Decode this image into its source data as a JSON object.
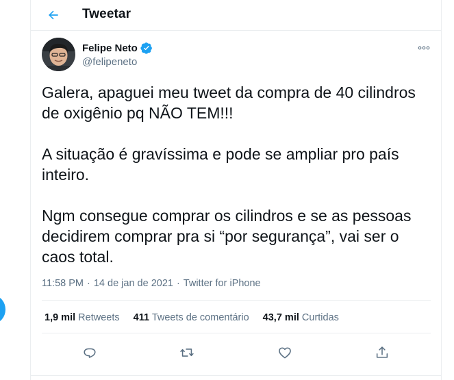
{
  "header": {
    "title": "Tweetar",
    "back_icon": "arrow-left-icon"
  },
  "author": {
    "name": "Felipe Neto",
    "handle": "@felipeneto",
    "verified": true,
    "verified_color": "#1da1f2"
  },
  "tweet": {
    "text": "Galera, apaguei meu tweet da compra de 40 cilindros\nde oxigênio pq NÃO TEM!!!\n\nA situação é gravíssima e pode se ampliar pro país\ninteiro.\n\nNgm consegue comprar os cilindros e se as pessoas\ndecidirem comprar pra si “por segurança”, vai ser o\ncaos total.",
    "time": "11:58 PM",
    "separator1": "·",
    "date": "14 de jan de 2021",
    "separator2": "·",
    "source": "Twitter for iPhone"
  },
  "stats": {
    "retweets_count": "1,9 mil",
    "retweets_label": "Retweets",
    "quotes_count": "411",
    "quotes_label": "Tweets de comentário",
    "likes_count": "43,7 mil",
    "likes_label": "Curtidas"
  },
  "actions": [
    {
      "name": "reply-icon"
    },
    {
      "name": "retweet-icon"
    },
    {
      "name": "like-icon"
    },
    {
      "name": "share-icon"
    }
  ],
  "colors": {
    "accent": "#1da1f2",
    "secondary_text": "#5b7083",
    "border": "#ebeef0"
  }
}
